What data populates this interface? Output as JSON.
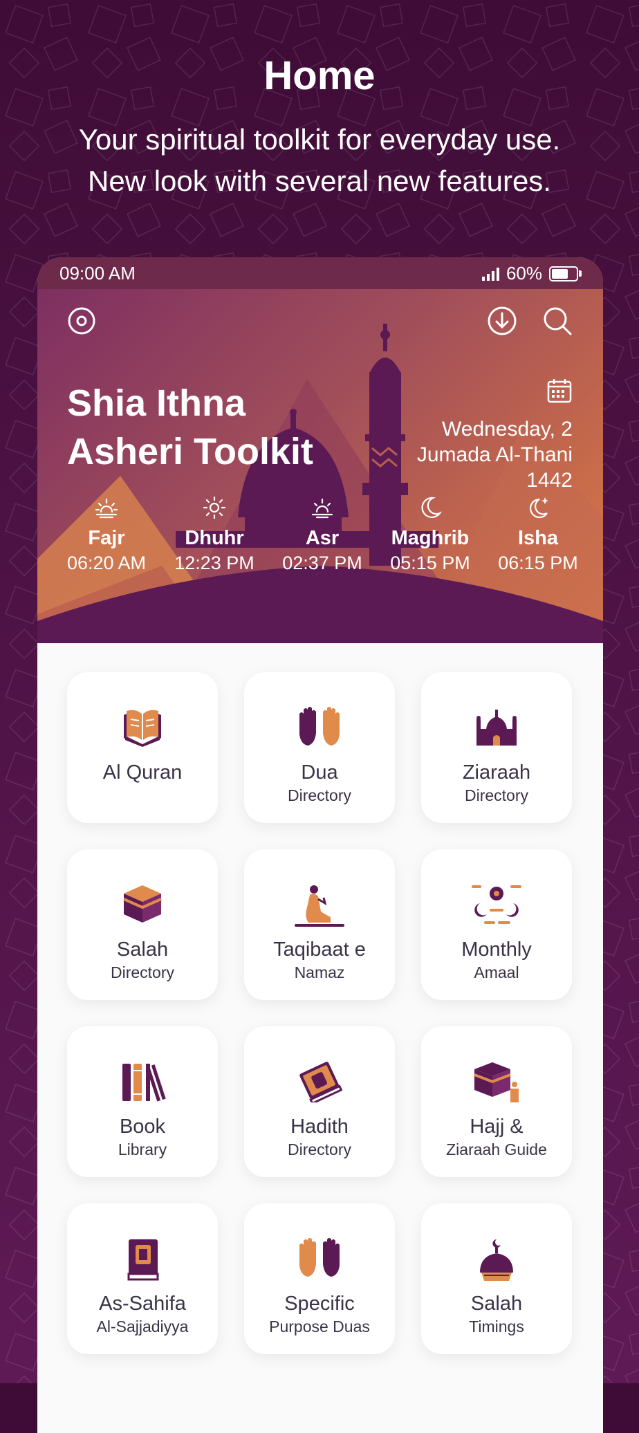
{
  "promo": {
    "title": "Home",
    "subtitle_line1": "Your spiritual toolkit for everyday use.",
    "subtitle_line2": "New look with several new features."
  },
  "status_bar": {
    "time": "09:00 AM",
    "battery": "60%"
  },
  "header": {
    "title_line1": "Shia Ithna",
    "title_line2": "Asheri Toolkit",
    "date_line1": "Wednesday, 2",
    "date_line2": "Jumada Al-Thani",
    "date_line3": "1442",
    "icons": [
      "settings-icon",
      "download-icon",
      "search-icon",
      "calendar-icon"
    ]
  },
  "prayers": [
    {
      "name": "Fajr",
      "time": "06:20 AM",
      "icon": "sunrise-icon"
    },
    {
      "name": "Dhuhr",
      "time": "12:23 PM",
      "icon": "sun-icon"
    },
    {
      "name": "Asr",
      "time": "02:37 PM",
      "icon": "sunset-icon"
    },
    {
      "name": "Maghrib",
      "time": "05:15 PM",
      "icon": "moon-icon"
    },
    {
      "name": "Isha",
      "time": "06:15 PM",
      "icon": "moon-star-icon"
    }
  ],
  "tiles": [
    {
      "line1": "Al Quran",
      "line2": "",
      "icon": "quran-icon"
    },
    {
      "line1": "Dua",
      "line2": "Directory",
      "icon": "praying-hands-icon"
    },
    {
      "line1": "Ziaraah",
      "line2": "Directory",
      "icon": "shrine-icon"
    },
    {
      "line1": "Salah",
      "line2": "Directory",
      "icon": "kaaba-icon"
    },
    {
      "line1": "Taqibaat e",
      "line2": "Namaz",
      "icon": "praying-man-icon"
    },
    {
      "line1": "Monthly",
      "line2": "Amaal",
      "icon": "lunar-phases-icon"
    },
    {
      "line1": "Book",
      "line2": "Library",
      "icon": "books-icon"
    },
    {
      "line1": "Hadith",
      "line2": "Directory",
      "icon": "hadith-book-icon"
    },
    {
      "line1": "Hajj &",
      "line2": "Ziaraah Guide",
      "icon": "hajj-icon"
    },
    {
      "line1": "As-Sahifa",
      "line2": "Al-Sajjadiyya",
      "icon": "sahifa-book-icon"
    },
    {
      "line1": "Specific",
      "line2": "Purpose Duas",
      "icon": "hands-open-icon"
    },
    {
      "line1": "Salah",
      "line2": "Timings",
      "icon": "mosque-dome-icon"
    }
  ],
  "colors": {
    "purple": "#5b1a54",
    "orange": "#e08a4c",
    "text": "#3a3347"
  }
}
